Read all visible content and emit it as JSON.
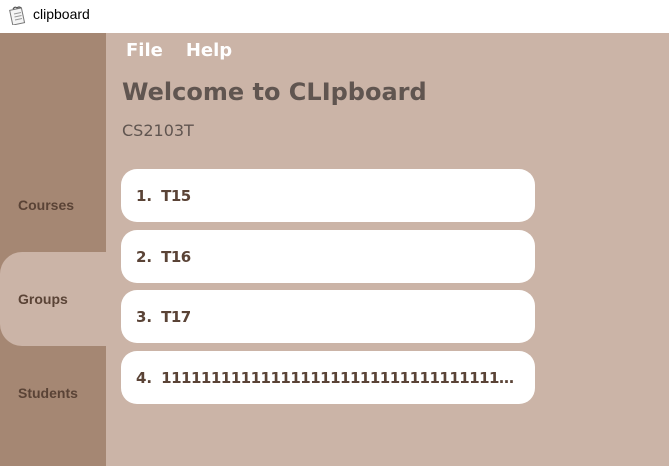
{
  "window": {
    "title": "clipboard"
  },
  "menu": {
    "file": "File",
    "help": "Help"
  },
  "header": {
    "title": "Welcome to CLIpboard",
    "subtitle": "CS2103T"
  },
  "sidebar": {
    "items": [
      {
        "label": "Courses"
      },
      {
        "label": "Groups"
      },
      {
        "label": "Students"
      }
    ],
    "active": "Groups"
  },
  "groups": [
    {
      "index": "1.",
      "name": "T15"
    },
    {
      "index": "2.",
      "name": "T16"
    },
    {
      "index": "3.",
      "name": "T17"
    },
    {
      "index": "4.",
      "name": "111111111111111111111111111111111111111111111111..."
    }
  ],
  "colors": {
    "sidebar": "#a58773",
    "background": "#cbb4a7",
    "card": "#ffffff",
    "text_dark": "#5a4336",
    "title_text": "#605550"
  },
  "icons": {
    "app": "notepad-icon"
  }
}
